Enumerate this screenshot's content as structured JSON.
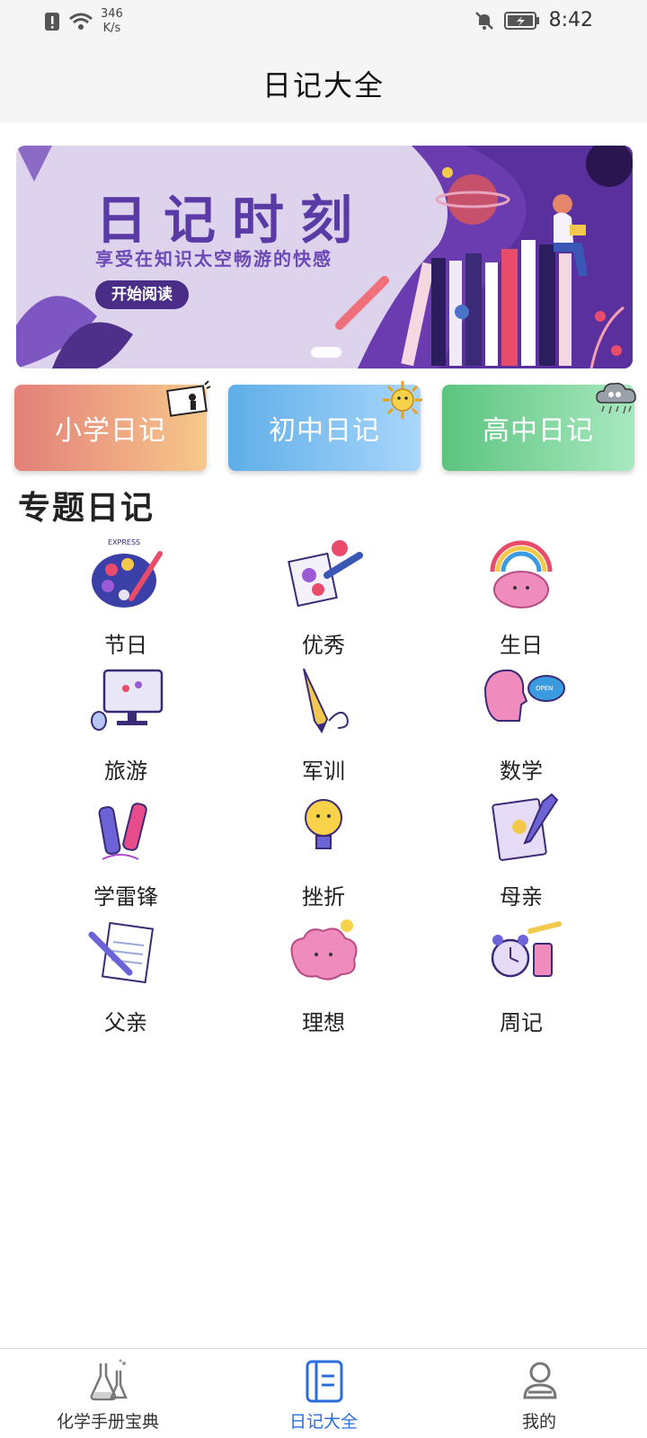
{
  "status_bar": {
    "net_speed_value": "346",
    "net_speed_unit": "K/s",
    "time": "8:42"
  },
  "header": {
    "title": "日记大全"
  },
  "banner": {
    "title": "日记时刻",
    "subtitle": "享受在知识太空畅游的快感",
    "button": "开始阅读",
    "colors": {
      "background": "#ddd3ec",
      "accent": "#5a3aa5"
    }
  },
  "grades": [
    {
      "label": "小学日记",
      "icon": "board-icon"
    },
    {
      "label": "初中日记",
      "icon": "sun-icon"
    },
    {
      "label": "高中日记",
      "icon": "cloud-icon"
    }
  ],
  "section": {
    "title": "专题日记"
  },
  "topics": [
    {
      "label": "节日",
      "icon": "palette-icon"
    },
    {
      "label": "优秀",
      "icon": "paint-brush-icon"
    },
    {
      "label": "生日",
      "icon": "rainbow-brain-icon"
    },
    {
      "label": "旅游",
      "icon": "computer-icon"
    },
    {
      "label": "军训",
      "icon": "pencil-icon"
    },
    {
      "label": "数学",
      "icon": "head-bubble-icon"
    },
    {
      "label": "学雷锋",
      "icon": "markers-icon"
    },
    {
      "label": "挫折",
      "icon": "lightbulb-icon"
    },
    {
      "label": "母亲",
      "icon": "notebook-icon"
    },
    {
      "label": "父亲",
      "icon": "notepad-icon"
    },
    {
      "label": "理想",
      "icon": "brain-icon"
    },
    {
      "label": "周记",
      "icon": "alarm-clock-icon"
    }
  ],
  "bottom_nav": [
    {
      "label": "化学手册宝典",
      "icon": "flask-icon",
      "active": false
    },
    {
      "label": "日记大全",
      "icon": "notebook-icon",
      "active": true
    },
    {
      "label": "我的",
      "icon": "person-icon",
      "active": false
    }
  ],
  "colors": {
    "active_tab": "#2a6edc",
    "inactive_tab": "#333333"
  }
}
